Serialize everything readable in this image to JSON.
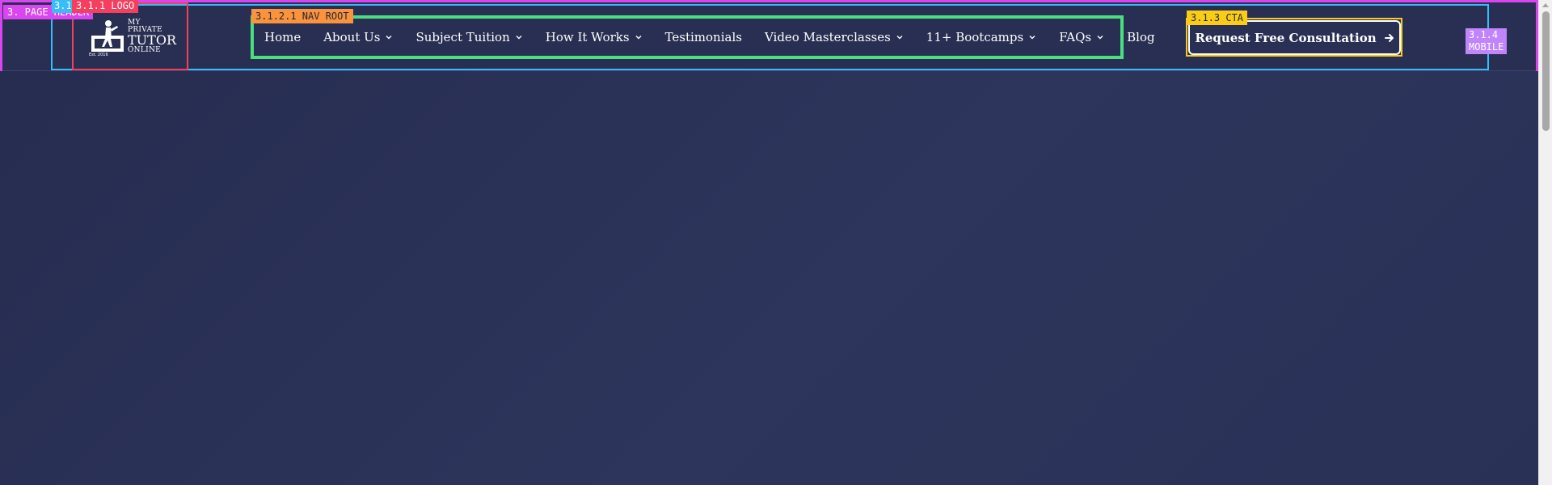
{
  "annotations": {
    "page_header": "3. PAGE HEADER",
    "container": "3.1",
    "logo": "3.1.1 LOGO",
    "nav_root": "3.1.2.1 NAV ROOT",
    "cta": "3.1.3 CTA",
    "mobile_line1": "3.1.4",
    "mobile_line2": "MOBILE"
  },
  "logo": {
    "line1": "MY PRIVATE",
    "line2": "TUTOR",
    "line3": "ONLINE",
    "est": "Est. 2016"
  },
  "nav": {
    "items": [
      {
        "label": "Home",
        "has_dropdown": false
      },
      {
        "label": "About Us",
        "has_dropdown": true
      },
      {
        "label": "Subject Tuition",
        "has_dropdown": true
      },
      {
        "label": "How It Works",
        "has_dropdown": true
      },
      {
        "label": "Testimonials",
        "has_dropdown": false
      },
      {
        "label": "Video Masterclasses",
        "has_dropdown": true
      },
      {
        "label": "11+ Bootcamps",
        "has_dropdown": true
      },
      {
        "label": "FAQs",
        "has_dropdown": true
      },
      {
        "label": "Blog",
        "has_dropdown": false
      }
    ]
  },
  "cta": {
    "label": "Request Free Consultation",
    "icon": "arrow-right-icon"
  },
  "colors": {
    "background": "#292f52",
    "page_header_outline": "#d946ef",
    "container_outline": "#38bdf8",
    "logo_outline": "#f43f5e",
    "nav_outline": "#4ade80",
    "nav_tag": "#fb923c",
    "cta_outline": "#facc15",
    "mobile_tag": "#c084fc"
  }
}
